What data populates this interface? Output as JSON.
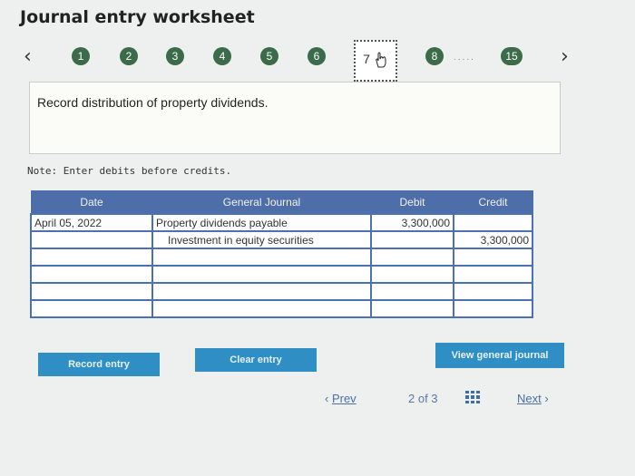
{
  "title": "Journal entry worksheet",
  "nav": {
    "prev_icon": "chevron-left-icon",
    "next_icon": "chevron-right-icon",
    "steps": [
      "1",
      "2",
      "3",
      "4",
      "5",
      "6",
      "7",
      "8",
      "15"
    ],
    "current_step": "7",
    "ellipsis": "....."
  },
  "prompt": "Record distribution of property dividends.",
  "note": "Note: Enter debits before credits.",
  "table": {
    "headers": [
      "Date",
      "General Journal",
      "Debit",
      "Credit"
    ],
    "rows": [
      {
        "date": "April 05, 2022",
        "account": "Property dividends payable",
        "debit": "3,300,000",
        "credit": ""
      },
      {
        "date": "",
        "account": "Investment in equity securities",
        "debit": "",
        "credit": "3,300,000"
      },
      {
        "date": "",
        "account": "",
        "debit": "",
        "credit": ""
      },
      {
        "date": "",
        "account": "",
        "debit": "",
        "credit": ""
      },
      {
        "date": "",
        "account": "",
        "debit": "",
        "credit": ""
      },
      {
        "date": "",
        "account": "",
        "debit": "",
        "credit": ""
      }
    ]
  },
  "buttons": {
    "record": "Record entry",
    "clear": "Clear entry",
    "view_journal": "View general journal"
  },
  "pager": {
    "prev": "Prev",
    "status": "2 of 3",
    "next": "Next",
    "grid_icon": "grid-icon",
    "colors": {
      "accent": "#4a6fa0",
      "button": "#2f8ec4",
      "step": "#3b6b48",
      "header": "#4d6ea8"
    }
  }
}
